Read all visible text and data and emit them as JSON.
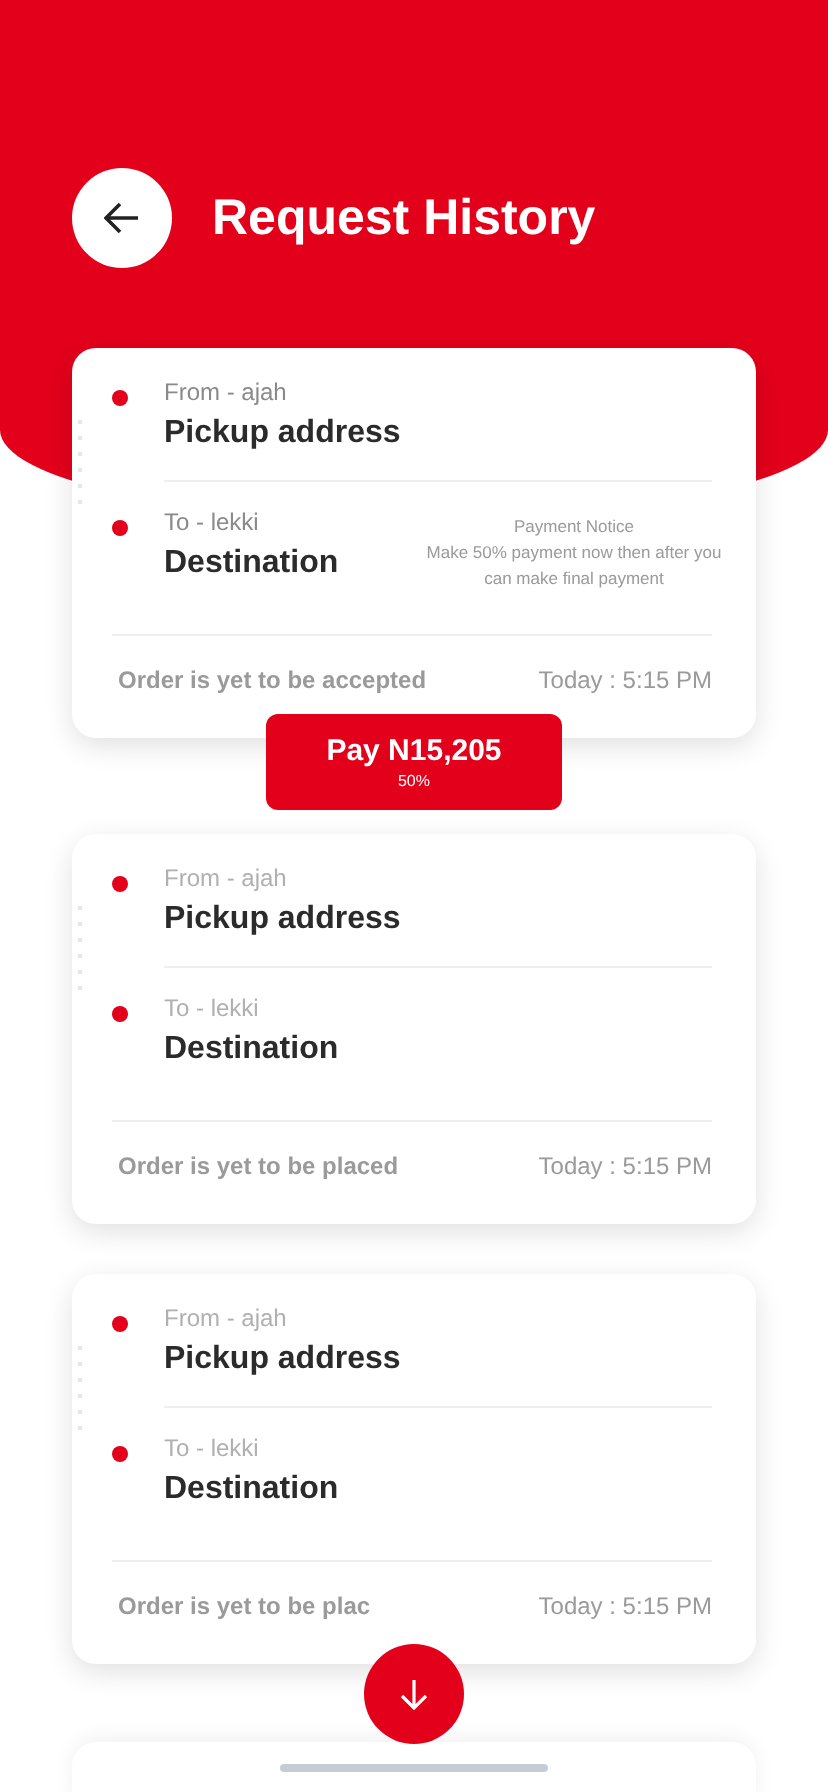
{
  "header": {
    "title": "Request History"
  },
  "requests": [
    {
      "from_label": "From - ajah",
      "pickup": "Pickup address",
      "to_label": "To - lekki",
      "destination": "Destination",
      "active": true,
      "notice": {
        "title": "Payment Notice",
        "text": "Make 50% payment now then after you can make final payment"
      },
      "status": "Order is yet to be accepted",
      "time": "Today : 5:15 PM",
      "payment": {
        "label": "Pay N15,205",
        "share": "50%"
      }
    },
    {
      "from_label": "From - ajah",
      "pickup": "Pickup address",
      "to_label": "To - lekki",
      "destination": "Destination",
      "active": false,
      "status": "Order is yet to be placed",
      "time": "Today : 5:15 PM"
    },
    {
      "from_label": "From - ajah",
      "pickup": "Pickup address",
      "to_label": "To - lekki",
      "destination": "Destination",
      "active": false,
      "status": "Order is yet to be plac",
      "time": "Today : 5:15 PM",
      "scroll_button": true
    }
  ]
}
